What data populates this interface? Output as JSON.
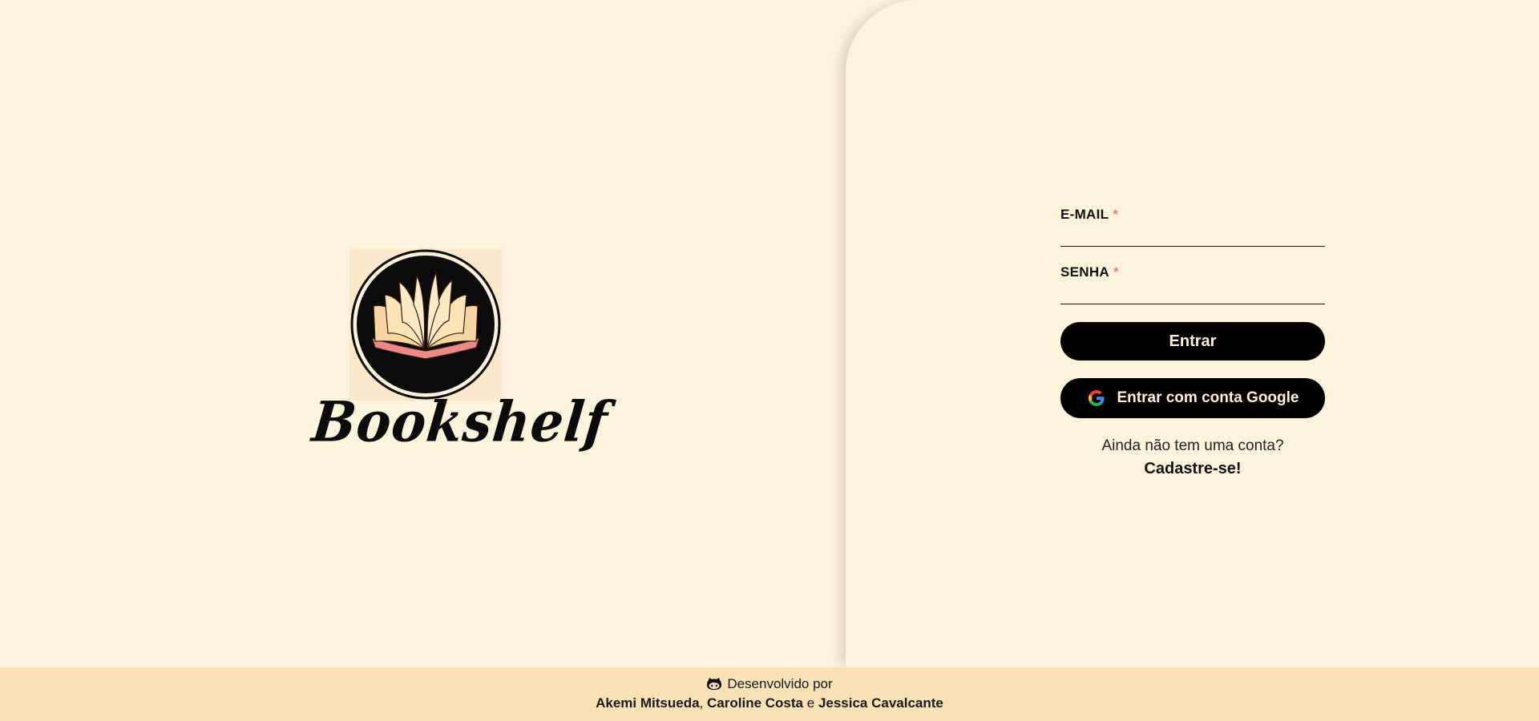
{
  "brand": {
    "name": "Bookshelf"
  },
  "login": {
    "email_label": "E-MAIL",
    "email_required_mark": "*",
    "password_label": "SENHA",
    "password_required_mark": "*",
    "submit_label": "Entrar",
    "google_label": "Entrar com conta Google",
    "signup_prompt": "Ainda não tem uma conta?",
    "signup_link": "Cadastre-se!"
  },
  "footer": {
    "developed_by": "Desenvolvido por",
    "authors": [
      "Akemi Mitsueda",
      "Caroline Costa",
      "Jessica Cavalcante"
    ],
    "separator_comma": ",",
    "separator_and": "e"
  },
  "colors": {
    "background": "#fcf3dc",
    "footer": "#f7e1b5",
    "button": "#000000",
    "button_text": "#fcf3dc",
    "required": "#d98572"
  },
  "icons": {
    "github": "github-icon",
    "google": "google-icon",
    "logo": "open-book-icon"
  }
}
